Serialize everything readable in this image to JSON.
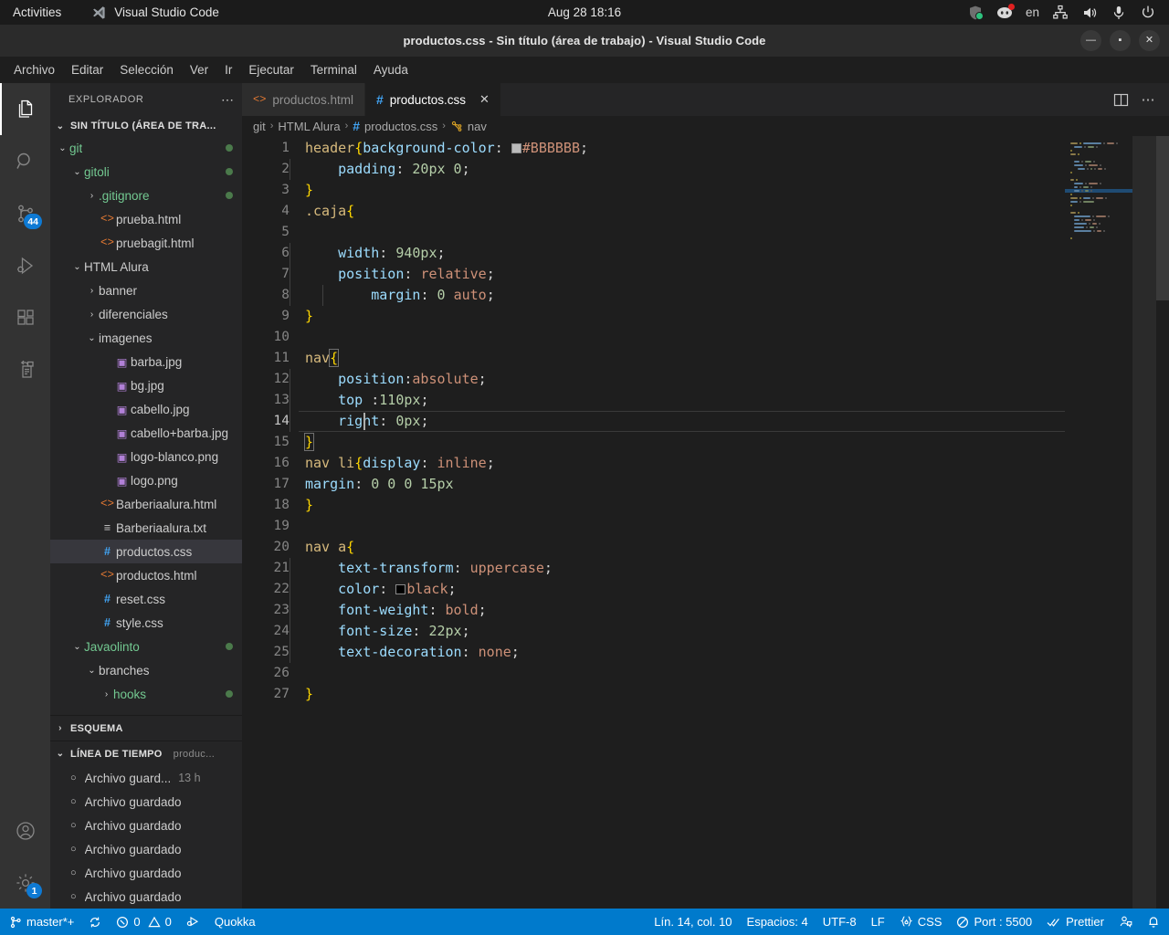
{
  "gnome": {
    "activities": "Activities",
    "app_name": "Visual Studio Code",
    "clock": "Aug 28  18:16",
    "language": "en",
    "tray_icons": [
      "shield-icon",
      "discord-icon",
      "network-icon",
      "volume-icon",
      "microphone-icon",
      "power-icon"
    ]
  },
  "titlebar": {
    "title": "productos.css - Sin título (área de trabajo) - Visual Studio Code",
    "minimize": "—",
    "maximize": "▪",
    "close": "✕"
  },
  "menubar": {
    "items": [
      "Archivo",
      "Editar",
      "Selección",
      "Ver",
      "Ir",
      "Ejecutar",
      "Terminal",
      "Ayuda"
    ]
  },
  "activitybar": {
    "items": [
      {
        "name": "explorer",
        "icon": "files-icon",
        "active": true,
        "badge": ""
      },
      {
        "name": "search",
        "icon": "search-icon",
        "active": false,
        "badge": ""
      },
      {
        "name": "source-control",
        "icon": "source-control-icon",
        "active": false,
        "badge": "44"
      },
      {
        "name": "run-and-debug",
        "icon": "debug-icon",
        "active": false,
        "badge": ""
      },
      {
        "name": "extensions",
        "icon": "extensions-icon",
        "active": false,
        "badge": ""
      },
      {
        "name": "remote-explorer",
        "icon": "remote-icon",
        "active": false,
        "badge": ""
      }
    ],
    "bottom": [
      {
        "name": "accounts",
        "icon": "account-icon",
        "badge": ""
      },
      {
        "name": "manage",
        "icon": "gear-icon",
        "badge": "1"
      }
    ]
  },
  "sidebar": {
    "title": "EXPLORADOR",
    "more_actions": "⋯",
    "workspace": "SIN TÍTULO (ÁREA DE TRA...",
    "tree": [
      {
        "label": "git",
        "indent": 1,
        "twist": "⌄",
        "icon": "",
        "green": true,
        "dot": true
      },
      {
        "label": "gitoli",
        "indent": 2,
        "twist": "⌄",
        "icon": "",
        "green": true,
        "dot": true
      },
      {
        "label": ".gitignore",
        "indent": 3,
        "twist": "›",
        "icon": "",
        "green": true,
        "dot": true
      },
      {
        "label": "prueba.html",
        "indent": 3,
        "twist": "",
        "icon": "html",
        "green": false,
        "dot": false
      },
      {
        "label": "pruebagit.html",
        "indent": 3,
        "twist": "",
        "icon": "html",
        "green": false,
        "dot": false
      },
      {
        "label": "HTML Alura",
        "indent": 2,
        "twist": "⌄",
        "icon": "",
        "green": false,
        "dot": false
      },
      {
        "label": "banner",
        "indent": 3,
        "twist": "›",
        "icon": "",
        "green": false,
        "dot": false
      },
      {
        "label": "diferenciales",
        "indent": 3,
        "twist": "›",
        "icon": "",
        "green": false,
        "dot": false
      },
      {
        "label": "imagenes",
        "indent": 3,
        "twist": "⌄",
        "icon": "",
        "green": false,
        "dot": false
      },
      {
        "label": "barba.jpg",
        "indent": 4,
        "twist": "",
        "icon": "img",
        "green": false,
        "dot": false
      },
      {
        "label": "bg.jpg",
        "indent": 4,
        "twist": "",
        "icon": "img",
        "green": false,
        "dot": false
      },
      {
        "label": "cabello.jpg",
        "indent": 4,
        "twist": "",
        "icon": "img",
        "green": false,
        "dot": false
      },
      {
        "label": "cabello+barba.jpg",
        "indent": 4,
        "twist": "",
        "icon": "img",
        "green": false,
        "dot": false
      },
      {
        "label": "logo-blanco.png",
        "indent": 4,
        "twist": "",
        "icon": "img",
        "green": false,
        "dot": false
      },
      {
        "label": "logo.png",
        "indent": 4,
        "twist": "",
        "icon": "img",
        "green": false,
        "dot": false
      },
      {
        "label": "Barberiaalura.html",
        "indent": 3,
        "twist": "",
        "icon": "html",
        "green": false,
        "dot": false
      },
      {
        "label": "Barberiaalura.txt",
        "indent": 3,
        "twist": "",
        "icon": "txt",
        "green": false,
        "dot": false
      },
      {
        "label": "productos.css",
        "indent": 3,
        "twist": "",
        "icon": "css",
        "green": false,
        "dot": false,
        "selected": true
      },
      {
        "label": "productos.html",
        "indent": 3,
        "twist": "",
        "icon": "html",
        "green": false,
        "dot": false
      },
      {
        "label": "reset.css",
        "indent": 3,
        "twist": "",
        "icon": "css",
        "green": false,
        "dot": false
      },
      {
        "label": "style.css",
        "indent": 3,
        "twist": "",
        "icon": "css",
        "green": false,
        "dot": false
      },
      {
        "label": "Javaolinto",
        "indent": 2,
        "twist": "⌄",
        "icon": "",
        "green": true,
        "dot": true
      },
      {
        "label": "branches",
        "indent": 3,
        "twist": "⌄",
        "icon": "",
        "green": false,
        "dot": false
      },
      {
        "label": "hooks",
        "indent": 4,
        "twist": "›",
        "icon": "",
        "green": true,
        "dot": true
      }
    ],
    "outline_section": "ESQUEMA",
    "timeline_section": "LÍNEA DE TIEMPO",
    "timeline_file": "produc...",
    "timeline": [
      {
        "label": "Archivo guard...",
        "ago": "13 h"
      },
      {
        "label": "Archivo guardado",
        "ago": ""
      },
      {
        "label": "Archivo guardado",
        "ago": ""
      },
      {
        "label": "Archivo guardado",
        "ago": ""
      },
      {
        "label": "Archivo guardado",
        "ago": ""
      },
      {
        "label": "Archivo guardado",
        "ago": ""
      }
    ]
  },
  "tabs": [
    {
      "label": "productos.html",
      "icon": "html",
      "active": false,
      "closable": false
    },
    {
      "label": "productos.css",
      "icon": "css",
      "active": true,
      "closable": true,
      "close": "✕"
    }
  ],
  "editor_actions": [
    "split-editor-icon",
    "more-actions-icon"
  ],
  "breadcrumb": {
    "parts": [
      "git",
      "HTML Alura",
      "productos.css",
      "nav"
    ],
    "separator": "›",
    "file_icon": "css",
    "symbol_icon": "symbol-ruleset-icon"
  },
  "code": {
    "language": "CSS",
    "lines": [
      {
        "n": 1,
        "tokens": [
          {
            "t": "header",
            "c": "sel"
          },
          {
            "t": "{",
            "c": "brace"
          },
          {
            "t": "background-color",
            "c": "prop"
          },
          {
            "t": ": ",
            "c": "punct"
          },
          {
            "t": "#BBBBBB",
            "c": "val",
            "swatch": "#BBBBBB"
          },
          {
            "t": ";",
            "c": "punct"
          }
        ],
        "indent": 0
      },
      {
        "n": 2,
        "tokens": [
          {
            "t": "    padding",
            "c": "prop"
          },
          {
            "t": ": ",
            "c": "punct"
          },
          {
            "t": "20px 0",
            "c": "num"
          },
          {
            "t": ";",
            "c": "punct"
          }
        ],
        "indent": 1
      },
      {
        "n": 3,
        "tokens": [
          {
            "t": "}",
            "c": "brace"
          }
        ],
        "indent": 0
      },
      {
        "n": 4,
        "tokens": [
          {
            "t": ".caja",
            "c": "cls"
          },
          {
            "t": "{",
            "c": "brace"
          }
        ],
        "indent": 0
      },
      {
        "n": 5,
        "tokens": [],
        "indent": 1
      },
      {
        "n": 6,
        "tokens": [
          {
            "t": "    width",
            "c": "prop"
          },
          {
            "t": ": ",
            "c": "punct"
          },
          {
            "t": "940px",
            "c": "num"
          },
          {
            "t": ";",
            "c": "punct"
          }
        ],
        "indent": 1
      },
      {
        "n": 7,
        "tokens": [
          {
            "t": "    position",
            "c": "prop"
          },
          {
            "t": ": ",
            "c": "punct"
          },
          {
            "t": "relative",
            "c": "val"
          },
          {
            "t": ";",
            "c": "punct"
          }
        ],
        "indent": 1
      },
      {
        "n": 8,
        "tokens": [
          {
            "t": "        margin",
            "c": "prop"
          },
          {
            "t": ": ",
            "c": "punct"
          },
          {
            "t": "0",
            "c": "num"
          },
          {
            "t": " ",
            "c": "punct"
          },
          {
            "t": "auto",
            "c": "val"
          },
          {
            "t": ";",
            "c": "punct"
          }
        ],
        "indent": 2
      },
      {
        "n": 9,
        "tokens": [
          {
            "t": "}",
            "c": "brace"
          }
        ],
        "indent": 0
      },
      {
        "n": 10,
        "tokens": [],
        "indent": 0
      },
      {
        "n": 11,
        "tokens": [
          {
            "t": "nav",
            "c": "sel"
          },
          {
            "t": "{",
            "c": "brace",
            "boxed": true
          }
        ],
        "indent": 0
      },
      {
        "n": 12,
        "tokens": [
          {
            "t": "    position",
            "c": "prop"
          },
          {
            "t": ":",
            "c": "punct"
          },
          {
            "t": "absolute",
            "c": "val"
          },
          {
            "t": ";",
            "c": "punct"
          }
        ],
        "indent": 1
      },
      {
        "n": 13,
        "tokens": [
          {
            "t": "    top ",
            "c": "prop"
          },
          {
            "t": ":",
            "c": "punct"
          },
          {
            "t": "110px",
            "c": "num"
          },
          {
            "t": ";",
            "c": "punct"
          }
        ],
        "indent": 1
      },
      {
        "n": 14,
        "tokens": [
          {
            "t": "    right",
            "c": "prop"
          },
          {
            "t": ": ",
            "c": "punct"
          },
          {
            "t": "0px",
            "c": "num"
          },
          {
            "t": ";",
            "c": "punct"
          }
        ],
        "indent": 1,
        "current": true
      },
      {
        "n": 15,
        "tokens": [
          {
            "t": "}",
            "c": "brace",
            "boxed": true
          }
        ],
        "indent": 0
      },
      {
        "n": 16,
        "tokens": [
          {
            "t": "nav li",
            "c": "sel"
          },
          {
            "t": "{",
            "c": "brace"
          },
          {
            "t": "display",
            "c": "prop"
          },
          {
            "t": ": ",
            "c": "punct"
          },
          {
            "t": "inline",
            "c": "val"
          },
          {
            "t": ";",
            "c": "punct"
          }
        ],
        "indent": 0
      },
      {
        "n": 17,
        "tokens": [
          {
            "t": "margin",
            "c": "prop"
          },
          {
            "t": ": ",
            "c": "punct"
          },
          {
            "t": "0 0 0 15px",
            "c": "num"
          }
        ],
        "indent": 0
      },
      {
        "n": 18,
        "tokens": [
          {
            "t": "}",
            "c": "brace"
          }
        ],
        "indent": 0
      },
      {
        "n": 19,
        "tokens": [],
        "indent": 0
      },
      {
        "n": 20,
        "tokens": [
          {
            "t": "nav a",
            "c": "sel"
          },
          {
            "t": "{",
            "c": "brace"
          }
        ],
        "indent": 0
      },
      {
        "n": 21,
        "tokens": [
          {
            "t": "    text-transform",
            "c": "prop"
          },
          {
            "t": ": ",
            "c": "punct"
          },
          {
            "t": "uppercase",
            "c": "val"
          },
          {
            "t": ";",
            "c": "punct"
          }
        ],
        "indent": 1
      },
      {
        "n": 22,
        "tokens": [
          {
            "t": "    color",
            "c": "prop"
          },
          {
            "t": ": ",
            "c": "punct"
          },
          {
            "t": "black",
            "c": "val",
            "swatch": "#000000"
          },
          {
            "t": ";",
            "c": "punct"
          }
        ],
        "indent": 1
      },
      {
        "n": 23,
        "tokens": [
          {
            "t": "    font-weight",
            "c": "prop"
          },
          {
            "t": ": ",
            "c": "punct"
          },
          {
            "t": "bold",
            "c": "val"
          },
          {
            "t": ";",
            "c": "punct"
          }
        ],
        "indent": 1
      },
      {
        "n": 24,
        "tokens": [
          {
            "t": "    font-size",
            "c": "prop"
          },
          {
            "t": ": ",
            "c": "punct"
          },
          {
            "t": "22px",
            "c": "num"
          },
          {
            "t": ";",
            "c": "punct"
          }
        ],
        "indent": 1
      },
      {
        "n": 25,
        "tokens": [
          {
            "t": "    text-decoration",
            "c": "prop"
          },
          {
            "t": ": ",
            "c": "punct"
          },
          {
            "t": "none",
            "c": "val"
          },
          {
            "t": ";",
            "c": "punct"
          }
        ],
        "indent": 1
      },
      {
        "n": 26,
        "tokens": [],
        "indent": 1
      },
      {
        "n": 27,
        "tokens": [
          {
            "t": "}",
            "c": "brace"
          }
        ],
        "indent": 0
      }
    ]
  },
  "statusbar": {
    "left": [
      {
        "name": "remote-branch",
        "icon": "branch-icon",
        "label": "master*+"
      },
      {
        "name": "sync-changes",
        "icon": "sync-icon",
        "label": ""
      },
      {
        "name": "problems",
        "icon": "error-warning-icon",
        "label": "0  0",
        "errors": "0",
        "warnings": "0"
      },
      {
        "name": "go-live-debug",
        "icon": "rocket-icon",
        "label": ""
      },
      {
        "name": "quokka",
        "icon": "",
        "label": "Quokka"
      }
    ],
    "right": [
      {
        "name": "cursor-position",
        "label": "Lín. 14, col. 10"
      },
      {
        "name": "indentation",
        "label": "Espacios: 4"
      },
      {
        "name": "encoding",
        "label": "UTF-8"
      },
      {
        "name": "eol",
        "label": "LF"
      },
      {
        "name": "language-mode",
        "icon": "css-icon",
        "label": "CSS"
      },
      {
        "name": "live-server-port",
        "icon": "circle-slash-icon",
        "label": "Port : 5500"
      },
      {
        "name": "prettier",
        "icon": "checks-icon",
        "label": "Prettier"
      },
      {
        "name": "feedback",
        "icon": "feedback-icon",
        "label": ""
      },
      {
        "name": "notifications",
        "icon": "bell-icon",
        "label": ""
      }
    ]
  }
}
